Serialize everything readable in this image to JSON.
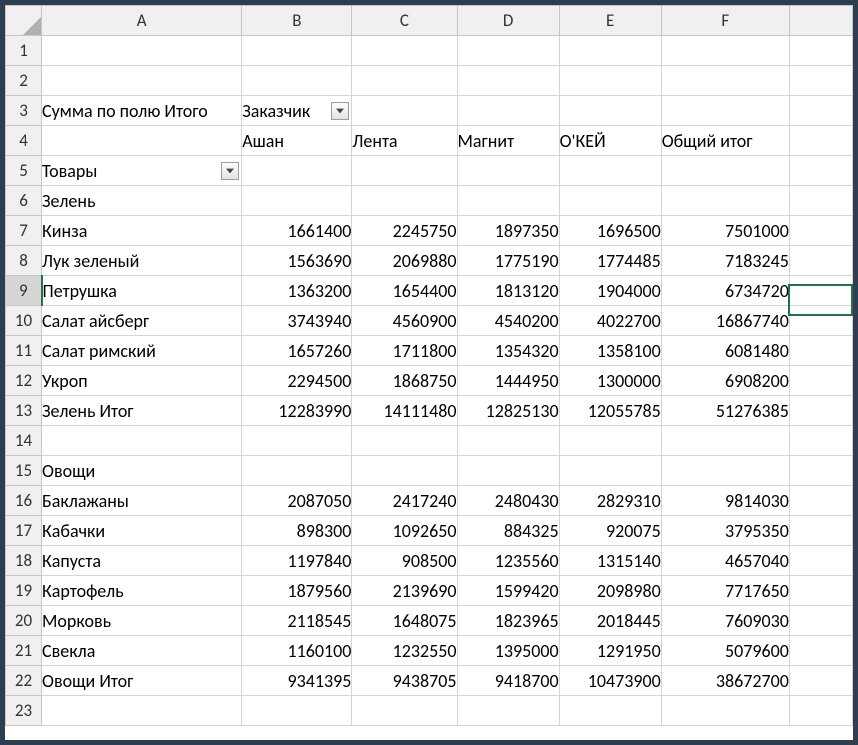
{
  "columns": [
    "A",
    "B",
    "C",
    "D",
    "E",
    "F",
    ""
  ],
  "label_row3_A": "Сумма по полю Итого",
  "label_row3_B": "Заказчик",
  "headers_row4": [
    "Ашан",
    "Лента",
    "Магнит",
    "О'КЕЙ",
    "Общий итог"
  ],
  "label_row5_A": "Товары",
  "group1_label": "Зелень",
  "group1_rows": [
    {
      "name": "Кинза",
      "v": [
        "1661400",
        "2245750",
        "1897350",
        "1696500",
        "7501000"
      ]
    },
    {
      "name": "Лук зеленый",
      "v": [
        "1563690",
        "2069880",
        "1775190",
        "1774485",
        "7183245"
      ]
    },
    {
      "name": "Петрушка",
      "v": [
        "1363200",
        "1654400",
        "1813120",
        "1904000",
        "6734720"
      ]
    },
    {
      "name": "Салат айсберг",
      "v": [
        "3743940",
        "4560900",
        "4540200",
        "4022700",
        "16867740"
      ]
    },
    {
      "name": "Салат римский",
      "v": [
        "1657260",
        "1711800",
        "1354320",
        "1358100",
        "6081480"
      ]
    },
    {
      "name": "Укроп",
      "v": [
        "2294500",
        "1868750",
        "1444950",
        "1300000",
        "6908200"
      ]
    }
  ],
  "group1_total_label": "Зелень Итог",
  "group1_total": [
    "12283990",
    "14111480",
    "12825130",
    "12055785",
    "51276385"
  ],
  "group2_label": "Овощи",
  "group2_rows": [
    {
      "name": "Баклажаны",
      "v": [
        "2087050",
        "2417240",
        "2480430",
        "2829310",
        "9814030"
      ]
    },
    {
      "name": "Кабачки",
      "v": [
        "898300",
        "1092650",
        "884325",
        "920075",
        "3795350"
      ]
    },
    {
      "name": "Капуста",
      "v": [
        "1197840",
        "908500",
        "1235560",
        "1315140",
        "4657040"
      ]
    },
    {
      "name": "Картофель",
      "v": [
        "1879560",
        "2139690",
        "1599420",
        "2098980",
        "7717650"
      ]
    },
    {
      "name": "Морковь",
      "v": [
        "2118545",
        "1648075",
        "1823965",
        "2018445",
        "7609030"
      ]
    },
    {
      "name": "Свекла",
      "v": [
        "1160100",
        "1232550",
        "1395000",
        "1291950",
        "5079600"
      ]
    }
  ],
  "group2_total_label": "Овощи Итог",
  "group2_total": [
    "9341395",
    "9438705",
    "9418700",
    "10473900",
    "38672700"
  ],
  "row_numbers": [
    "1",
    "2",
    "3",
    "4",
    "5",
    "6",
    "7",
    "8",
    "9",
    "10",
    "11",
    "12",
    "13",
    "14",
    "15",
    "16",
    "17",
    "18",
    "19",
    "20",
    "21",
    "22",
    "23"
  ]
}
